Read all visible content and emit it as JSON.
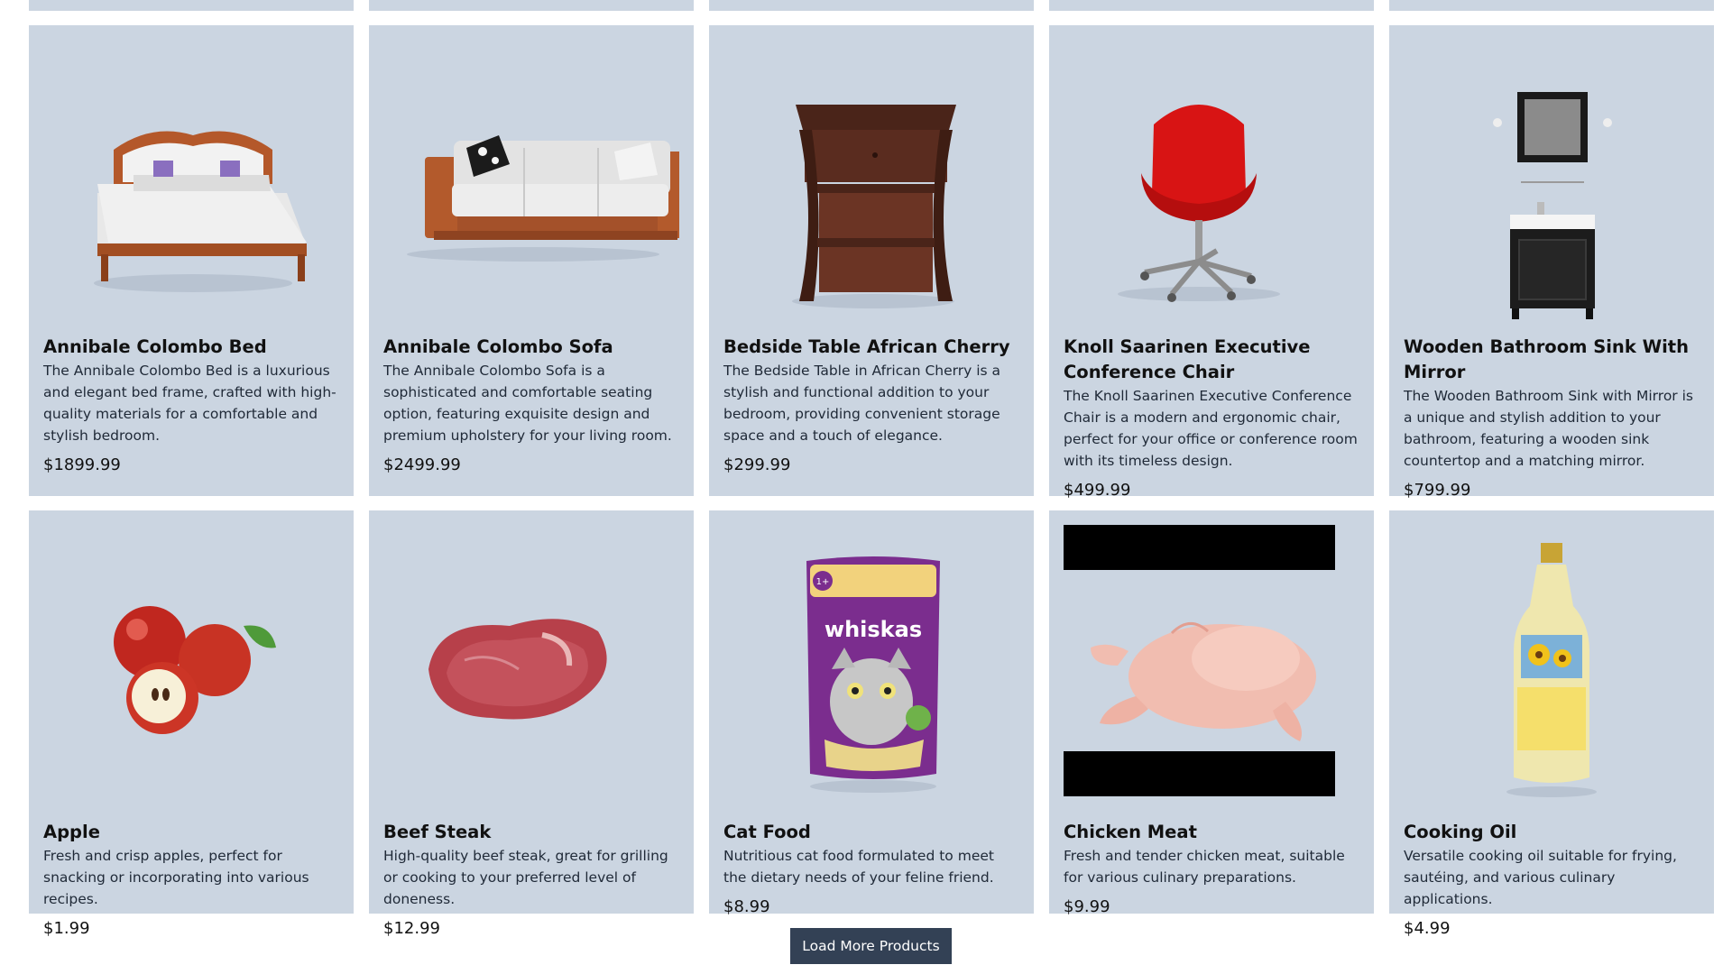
{
  "colors": {
    "card_background": "#cbd5e1",
    "page_background": "#ffffff",
    "button_background": "#334155",
    "button_text": "#ffffff"
  },
  "products": [
    {
      "title": "Annibale Colombo Bed",
      "description": "The Annibale Colombo Bed is a luxurious and elegant bed frame, crafted with high-quality materials for a comfortable and stylish bedroom.",
      "price": "$1899.99",
      "image_icon": "bed-image"
    },
    {
      "title": "Annibale Colombo Sofa",
      "description": "The Annibale Colombo Sofa is a sophisticated and comfortable seating option, featuring exquisite design and premium upholstery for your living room.",
      "price": "$2499.99",
      "image_icon": "sofa-image"
    },
    {
      "title": "Bedside Table African Cherry",
      "description": "The Bedside Table in African Cherry is a stylish and functional addition to your bedroom, providing convenient storage space and a touch of elegance.",
      "price": "$299.99",
      "image_icon": "bedside-table-image"
    },
    {
      "title": "Knoll Saarinen Executive Conference Chair",
      "description": "The Knoll Saarinen Executive Conference Chair is a modern and ergonomic chair, perfect for your office or conference room with its timeless design.",
      "price": "$499.99",
      "image_icon": "chair-image"
    },
    {
      "title": "Wooden Bathroom Sink With Mirror",
      "description": "The Wooden Bathroom Sink with Mirror is a unique and stylish addition to your bathroom, featuring a wooden sink countertop and a matching mirror.",
      "price": "$799.99",
      "image_icon": "bathroom-sink-image"
    },
    {
      "title": "Apple",
      "description": "Fresh and crisp apples, perfect for snacking or incorporating into various recipes.",
      "price": "$1.99",
      "image_icon": "apple-image"
    },
    {
      "title": "Beef Steak",
      "description": "High-quality beef steak, great for grilling or cooking to your preferred level of doneness.",
      "price": "$12.99",
      "image_icon": "steak-image"
    },
    {
      "title": "Cat Food",
      "description": "Nutritious cat food formulated to meet the dietary needs of your feline friend.",
      "price": "$8.99",
      "image_icon": "cat-food-image",
      "package_text": "whiskas"
    },
    {
      "title": "Chicken Meat",
      "description": "Fresh and tender chicken meat, suitable for various culinary preparations.",
      "price": "$9.99",
      "image_icon": "chicken-image"
    },
    {
      "title": "Cooking Oil",
      "description": "Versatile cooking oil suitable for frying, sautéing, and various culinary applications.",
      "price": "$4.99",
      "image_icon": "cooking-oil-image"
    }
  ],
  "load_more_label": "Load More Products"
}
